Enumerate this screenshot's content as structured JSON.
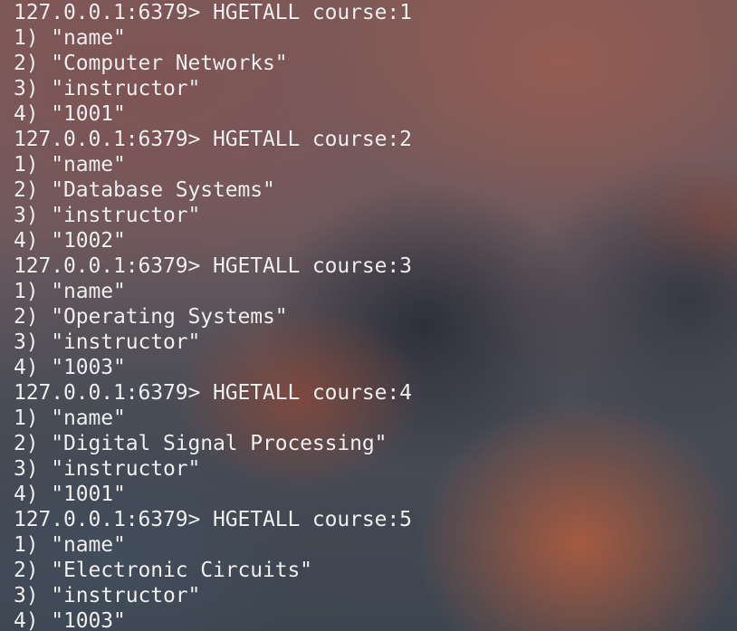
{
  "terminal": {
    "lines": [
      "127.0.0.1:6379> HGETALL course:1",
      "1) \"name\"",
      "2) \"Computer Networks\"",
      "3) \"instructor\"",
      "4) \"1001\"",
      "127.0.0.1:6379> HGETALL course:2",
      "1) \"name\"",
      "2) \"Database Systems\"",
      "3) \"instructor\"",
      "4) \"1002\"",
      "127.0.0.1:6379> HGETALL course:3",
      "1) \"name\"",
      "2) \"Operating Systems\"",
      "3) \"instructor\"",
      "4) \"1003\"",
      "127.0.0.1:6379> HGETALL course:4",
      "1) \"name\"",
      "2) \"Digital Signal Processing\"",
      "3) \"instructor\"",
      "4) \"1001\"",
      "127.0.0.1:6379> HGETALL course:5",
      "1) \"name\"",
      "2) \"Electronic Circuits\"",
      "3) \"instructor\"",
      "4) \"1003\""
    ]
  },
  "colors": {
    "text": "#f0f0f0"
  }
}
